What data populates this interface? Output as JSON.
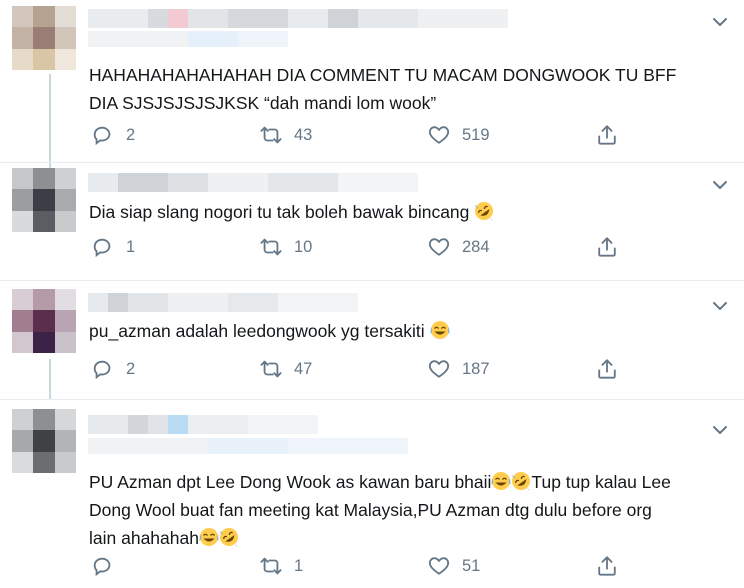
{
  "tweets": [
    {
      "text": "HAHAHAHAHAHAHAH DIA COMMENT TU MACAM DONGWOOK TU BFF DIA SJSJSJSJSJKSK “dah mandi lom wook”",
      "replies": "2",
      "retweets": "43",
      "likes": "519"
    },
    {
      "text": "Dia siap slang nogori tu tak boleh bawak bincang",
      "replies": "1",
      "retweets": "10",
      "likes": "284"
    },
    {
      "text": "pu_azman adalah leedongwook yg tersakiti",
      "replies": "2",
      "retweets": "47",
      "likes": "187"
    },
    {
      "text_line1": "PU Azman dpt Lee Dong Wook as kawan baru bhaii",
      "text_line1b": "Tup tup kalau Lee",
      "text_line2": "Dong Wool buat fan meeting kat Malaysia,PU Azman dtg dulu before org",
      "text_line3": "lain ahahahah",
      "replies": "",
      "retweets": "1",
      "likes": "51"
    }
  ],
  "icons": {
    "reply": "reply-icon",
    "retweet": "retweet-icon",
    "like": "heart-icon",
    "share": "share-icon",
    "more": "chevron-down-icon",
    "rofl": "rolling-on-floor-laughing-emoji",
    "joy": "tears-of-joy-emoji"
  },
  "colors": {
    "icon": "#657786",
    "text": "#14171a",
    "divider": "#e6ecf0",
    "thread": "#ccd6dd"
  }
}
